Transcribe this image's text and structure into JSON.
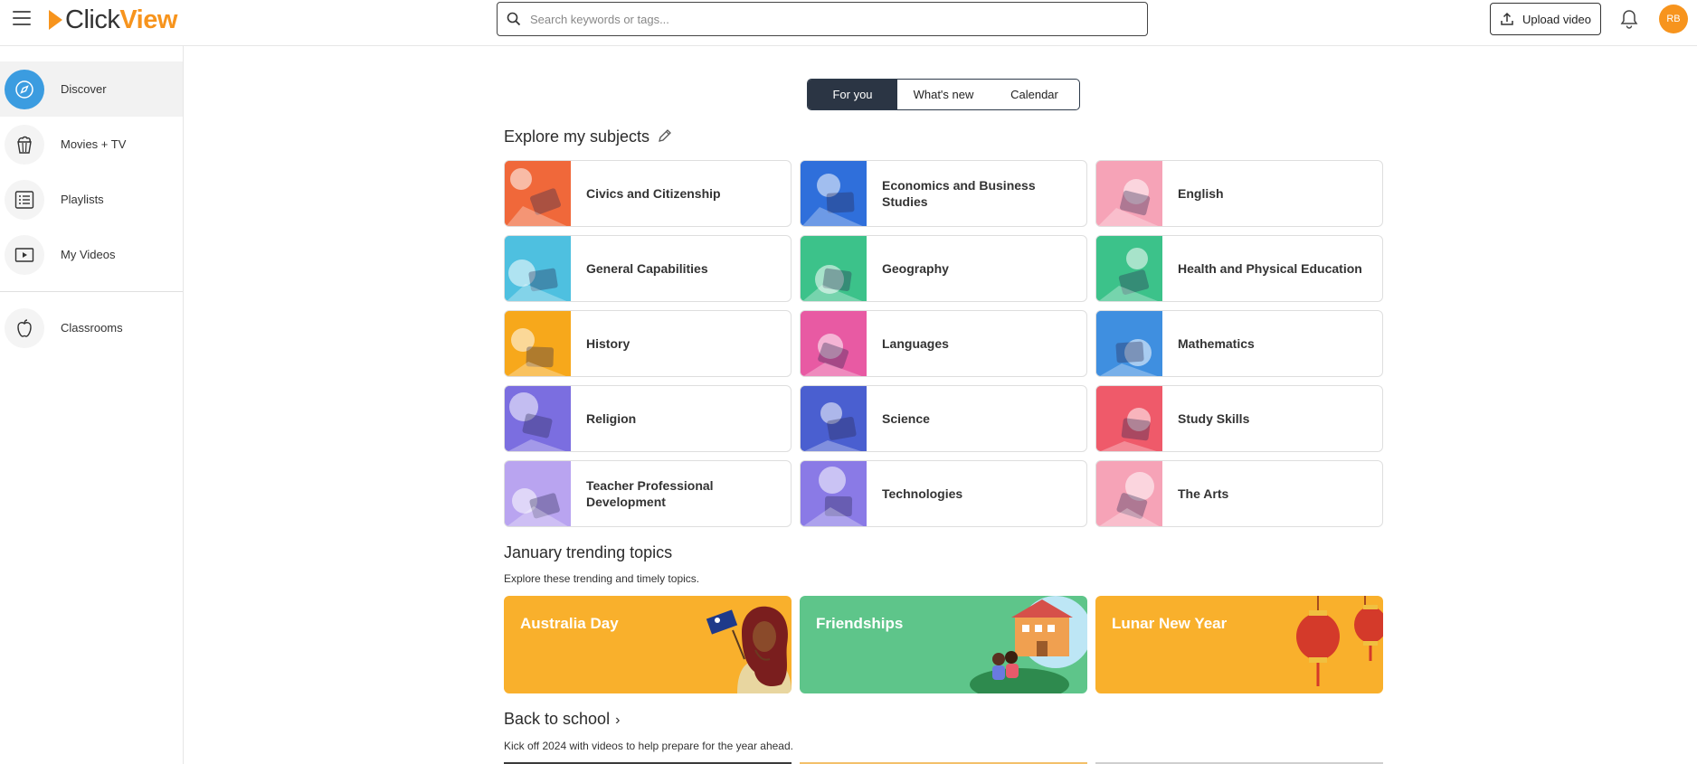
{
  "header": {
    "logo": {
      "part1": "Click",
      "part2": "View"
    },
    "search_placeholder": "Search keywords or tags...",
    "upload_label": "Upload video",
    "avatar_initials": "RB"
  },
  "sidebar": {
    "items": [
      {
        "label": "Discover",
        "icon": "compass-icon"
      },
      {
        "label": "Movies + TV",
        "icon": "popcorn-icon"
      },
      {
        "label": "Playlists",
        "icon": "list-icon"
      },
      {
        "label": "My Videos",
        "icon": "play-box-icon"
      },
      {
        "label": "Classrooms",
        "icon": "apple-icon"
      }
    ]
  },
  "tabs": [
    {
      "label": "For you"
    },
    {
      "label": "What's new"
    },
    {
      "label": "Calendar"
    }
  ],
  "subjects": {
    "title": "Explore my subjects",
    "items": [
      {
        "name": "Civics and Citizenship",
        "color": "#f0683a"
      },
      {
        "name": "Economics and Business Studies",
        "color": "#2f6fdb"
      },
      {
        "name": "English",
        "color": "#f6a3b7"
      },
      {
        "name": "General Capabilities",
        "color": "#4ec0e0"
      },
      {
        "name": "Geography",
        "color": "#3cc28a"
      },
      {
        "name": "Health and Physical Education",
        "color": "#3cc28a"
      },
      {
        "name": "History",
        "color": "#f7a81b"
      },
      {
        "name": "Languages",
        "color": "#e85aa3"
      },
      {
        "name": "Mathematics",
        "color": "#3f8fe0"
      },
      {
        "name": "Religion",
        "color": "#7b6ee0"
      },
      {
        "name": "Science",
        "color": "#4a5fd0"
      },
      {
        "name": "Study Skills",
        "color": "#ef5a6a"
      },
      {
        "name": "Teacher Professional Development",
        "color": "#b9a4f0"
      },
      {
        "name": "Technologies",
        "color": "#8a7ae6"
      },
      {
        "name": "The Arts",
        "color": "#f6a3b7"
      }
    ]
  },
  "trending": {
    "title": "January trending topics",
    "subtitle": "Explore these trending and timely topics.",
    "items": [
      {
        "label": "Australia Day",
        "color": "#f9b02c"
      },
      {
        "label": "Friendships",
        "color": "#5ec58a"
      },
      {
        "label": "Lunar New Year",
        "color": "#f9b02c"
      }
    ]
  },
  "back_to_school": {
    "title": "Back to school",
    "chevron": "›",
    "subtitle": "Kick off 2024 with videos to help prepare for the year ahead."
  }
}
